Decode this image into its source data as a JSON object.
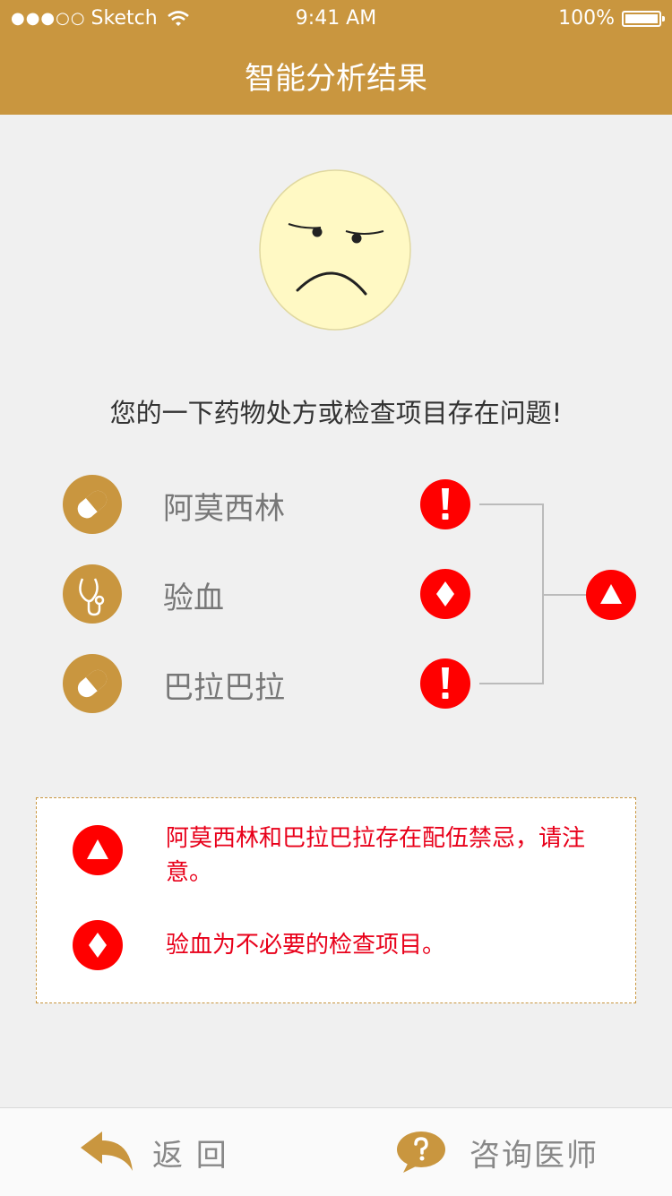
{
  "status_bar": {
    "signal": "●●●○○",
    "carrier": "Sketch",
    "time": "9:41 AM",
    "battery": "100%"
  },
  "header": {
    "title": "智能分析结果"
  },
  "result": {
    "face_icon": "sad-face-icon",
    "message": "您的一下药物处方或检查项目存在问题!"
  },
  "items": [
    {
      "label": "阿莫西林",
      "icon": "pill-icon",
      "mark": "exclamation"
    },
    {
      "label": "验血",
      "icon": "stethoscope-icon",
      "mark": "diamond"
    },
    {
      "label": "巴拉巴拉",
      "icon": "pill-icon",
      "mark": "exclamation"
    }
  ],
  "combined_mark": "triangle",
  "legend": [
    {
      "mark": "triangle",
      "text": "阿莫西林和巴拉巴拉存在配伍禁忌，请注意。"
    },
    {
      "mark": "diamond",
      "text": "验血为不必要的检查项目。"
    }
  ],
  "footer": {
    "back_label": "返 回",
    "consult_label": "咨询医师"
  },
  "colors": {
    "brand": "#c9963f",
    "alert": "#ff0000",
    "alert_text": "#e8001a"
  }
}
